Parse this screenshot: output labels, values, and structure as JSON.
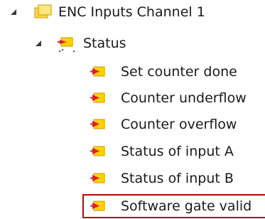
{
  "tree": {
    "root": {
      "label": "ENC Inputs Channel 1",
      "expanded": true,
      "icon": "folder-input-icon"
    },
    "status": {
      "label": "Status",
      "expanded": true,
      "icon": "input-variable-group-icon"
    },
    "items": [
      {
        "label": "Set counter done",
        "icon": "input-variable-icon"
      },
      {
        "label": "Counter underflow",
        "icon": "input-variable-icon"
      },
      {
        "label": "Counter overflow",
        "icon": "input-variable-icon"
      },
      {
        "label": "Status of input A",
        "icon": "input-variable-icon"
      },
      {
        "label": "Status of input B",
        "icon": "input-variable-icon"
      },
      {
        "label": "Software gate valid",
        "icon": "input-variable-icon",
        "highlighted": true
      }
    ]
  },
  "colors": {
    "highlight_border": "#c00000",
    "folder_fill": "#ffd84a",
    "folder_border": "#d4a000",
    "variable_fill": "#ffd200",
    "variable_arrow": "#e02020"
  }
}
